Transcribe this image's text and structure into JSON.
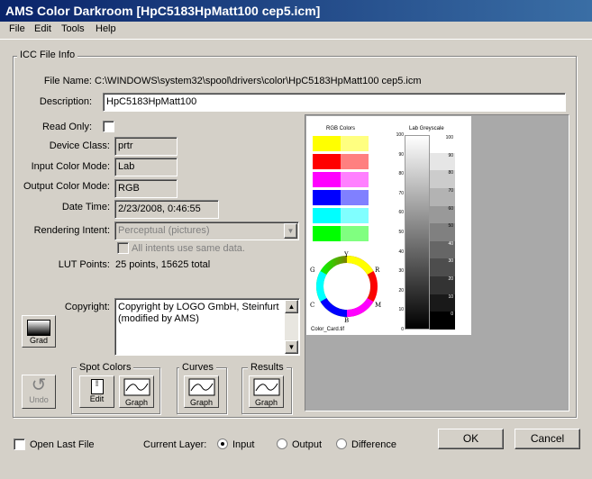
{
  "window": {
    "title": "AMS Color Darkroom [HpC5183HpMatt100 cep5.icm]"
  },
  "menu": {
    "file": "File",
    "edit": "Edit",
    "tools": "Tools",
    "help": "Help"
  },
  "icc": {
    "group_label": "ICC File Info",
    "file_name_label": "File Name:",
    "file_name": "C:\\WINDOWS\\system32\\spool\\drivers\\color\\HpC5183HpMatt100 cep5.icm",
    "description_label": "Description:",
    "description": "HpC5183HpMatt100",
    "read_only_label": "Read Only:",
    "device_class_label": "Device Class:",
    "device_class": "prtr",
    "input_mode_label": "Input Color Mode:",
    "input_mode": "Lab",
    "output_mode_label": "Output Color Mode:",
    "output_mode": "RGB",
    "datetime_label": "Date Time:",
    "datetime": "2/23/2008, 0:46:55",
    "intent_label": "Rendering Intent:",
    "intent": "Perceptual (pictures)",
    "all_intents_label": "All intents use same data.",
    "lut_label": "LUT Points:",
    "lut_value": "25 points, 15625 total",
    "copyright_label": "Copyright:",
    "copyright": "Copyright by LOGO GmbH, Steinfurt (modified by AMS)"
  },
  "preview": {
    "rgb_title": "RGB Colors",
    "lab_title": "Lab Greyscale",
    "wheel_y": "Y",
    "wheel_g": "G",
    "wheel_r": "R",
    "wheel_c": "C",
    "wheel_m": "M",
    "wheel_b": "B",
    "file_caption": "Color_Card.tif",
    "gray_axis": [
      "100",
      "90",
      "80",
      "70",
      "60",
      "50",
      "40",
      "30",
      "20",
      "10",
      "0"
    ],
    "gray_right": [
      "100",
      "90",
      "80",
      "70",
      "60",
      "50",
      "40",
      "30",
      "20",
      "10",
      "0"
    ],
    "swatch_colors": [
      [
        "#ffff00",
        "#ffff80"
      ],
      [
        "#ff0000",
        "#ff8080"
      ],
      [
        "#ff00ff",
        "#ff80ff"
      ],
      [
        "#0000ff",
        "#8080ff"
      ],
      [
        "#00ffff",
        "#80ffff"
      ],
      [
        "#00ff00",
        "#80ff80"
      ]
    ]
  },
  "buttons": {
    "grad": "Grad",
    "undo": "Undo",
    "spot_colors": "Spot Colors",
    "edit": "Edit",
    "graph": "Graph",
    "curves": "Curves",
    "curves_graph": "Graph",
    "results": "Results",
    "results_graph": "Graph",
    "ok": "OK",
    "cancel": "Cancel"
  },
  "footer": {
    "open_last_label": "Open Last File",
    "current_layer_label": "Current Layer:",
    "input": "Input",
    "output": "Output",
    "difference": "Difference"
  }
}
